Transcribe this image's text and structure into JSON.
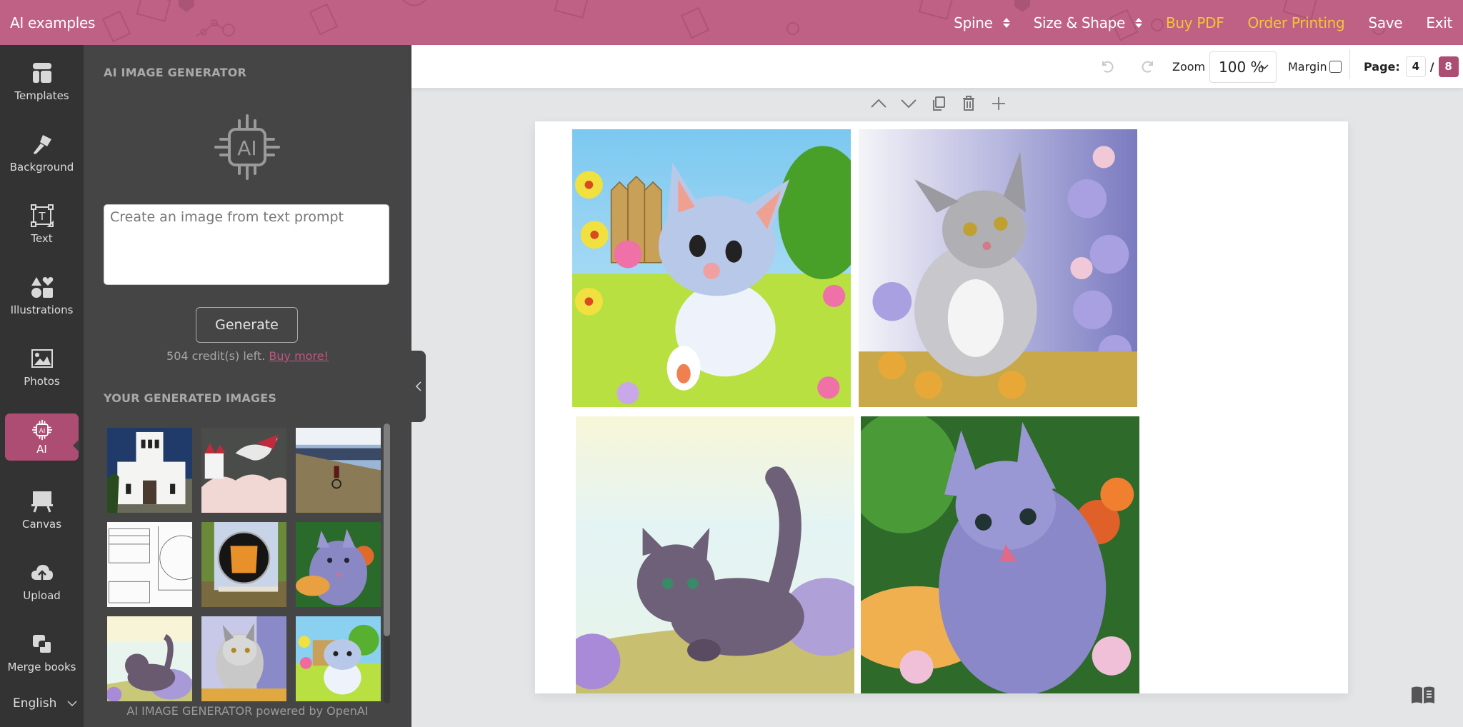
{
  "header": {
    "title": "AI examples",
    "nav": [
      {
        "label": "Spine",
        "type": "dropdown"
      },
      {
        "label": "Size & Shape",
        "type": "dropdown"
      },
      {
        "label": "Buy PDF",
        "type": "accent"
      },
      {
        "label": "Order Printing",
        "type": "accent"
      },
      {
        "label": "Save",
        "type": "plain"
      },
      {
        "label": "Exit",
        "type": "plain"
      }
    ],
    "accent_color": "#f5c437",
    "brand_color": "#be6185"
  },
  "rail": {
    "items": [
      {
        "label": "Templates",
        "icon": "templates-icon"
      },
      {
        "label": "Background",
        "icon": "paintbrush-icon"
      },
      {
        "label": "Text",
        "icon": "text-box-icon"
      },
      {
        "label": "Illustrations",
        "icon": "shapes-icon"
      },
      {
        "label": "Photos",
        "icon": "image-icon"
      },
      {
        "label": "AI",
        "icon": "ai-chip-icon",
        "active": true
      },
      {
        "label": "Canvas",
        "icon": "easel-icon"
      },
      {
        "label": "Upload",
        "icon": "cloud-upload-icon"
      },
      {
        "label": "Merge books",
        "icon": "merge-icon"
      }
    ],
    "language": "English"
  },
  "panel": {
    "heading": "AI IMAGE GENERATOR",
    "prompt_placeholder": "Create an image from text prompt",
    "prompt_value": "",
    "generate_label": "Generate",
    "credits_text": "504 credit(s) left.",
    "buy_more_label": "Buy more!",
    "generated_heading": "YOUR GENERATED IMAGES",
    "thumbnails": [
      {
        "subject": "white church"
      },
      {
        "subject": "castle and dragon"
      },
      {
        "subject": "cyclist on hill"
      },
      {
        "subject": "technical drawing"
      },
      {
        "subject": "solar oven"
      },
      {
        "subject": "painted kitten licking"
      },
      {
        "subject": "purple kitten walking"
      },
      {
        "subject": "watercolor grey kitten"
      },
      {
        "subject": "cartoon kitten in garden"
      }
    ],
    "footer": "AI IMAGE GENERATOR powered by OpenAI"
  },
  "toolbar": {
    "zoom_label": "Zoom",
    "zoom_value": "100 %",
    "margin_label": "Margin",
    "margin_checked": false,
    "page_label": "Page:",
    "current_page": "4",
    "separator": "/",
    "total_pages": "8"
  },
  "page": {
    "images": [
      {
        "subject": "cartoon kitten in garden"
      },
      {
        "subject": "watercolor grey kitten"
      },
      {
        "subject": "purple kitten walking"
      },
      {
        "subject": "painted kitten licking"
      }
    ]
  }
}
